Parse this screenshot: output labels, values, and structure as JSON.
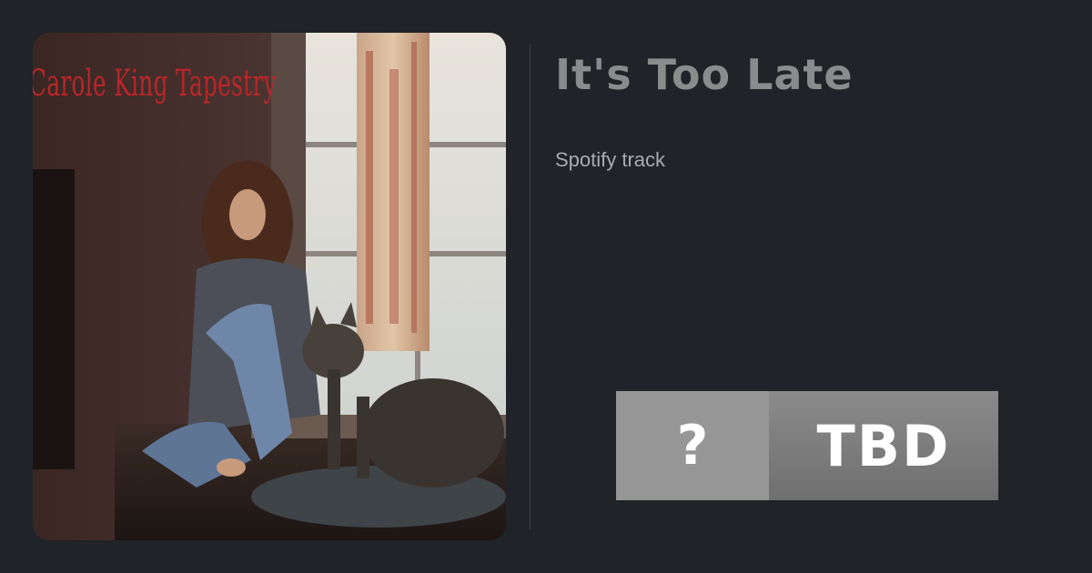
{
  "track": {
    "title": "It's Too Late",
    "subtitle": "Spotify track"
  },
  "cover": {
    "alt": "Carole King Tapestry",
    "text": "Carole King Tapestry"
  },
  "badge": {
    "icon": "?",
    "label": "TBD"
  },
  "colors": {
    "background": "#202327",
    "title": "#8a8b8c",
    "subtitle": "#a9abad",
    "badge_left": "#969696",
    "badge_right": "#7d7d7d",
    "cover_text": "#b8262a"
  }
}
